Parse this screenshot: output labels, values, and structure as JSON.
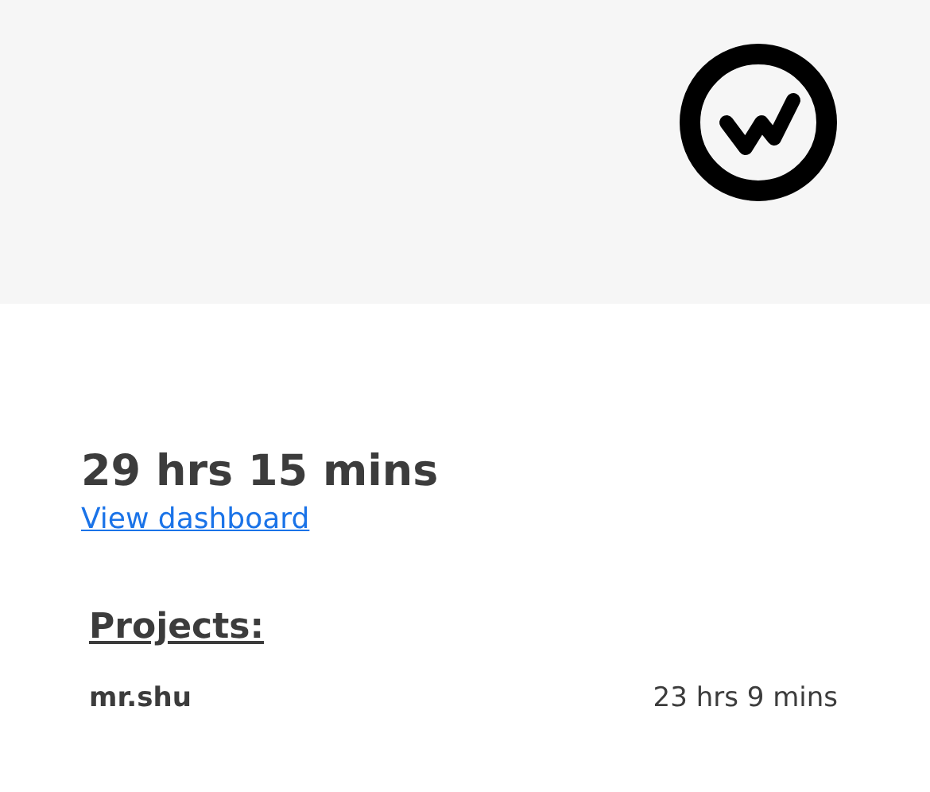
{
  "total_time": "29 hrs 15 mins",
  "dashboard_link": "View dashboard",
  "projects": {
    "heading": "Projects:",
    "rows": [
      {
        "name": "mr.shu",
        "time": "23 hrs 9 mins"
      }
    ]
  }
}
